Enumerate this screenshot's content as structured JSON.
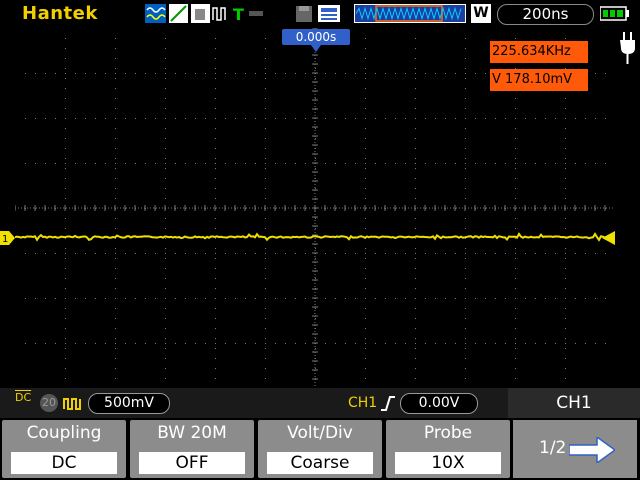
{
  "topbar": {
    "brand": "Hantek",
    "timebase": "200ns",
    "wave_mode": "W"
  },
  "screen": {
    "trigger_position": "0.000s",
    "measurements": [
      {
        "label": "225.634KHz"
      },
      {
        "label": "V 178.10mV"
      }
    ],
    "channel_marker": "1"
  },
  "status": {
    "coupling_icon": "DC",
    "bw_icon": "20",
    "volts_div": "500mV",
    "trigger_channel": "CH1",
    "trigger_level": "0.00V",
    "active_channel": "CH1"
  },
  "menu": {
    "items": [
      {
        "label": "Coupling",
        "value": "DC"
      },
      {
        "label": "BW 20M",
        "value": "OFF"
      },
      {
        "label": "Volt/Div",
        "value": "Coarse"
      },
      {
        "label": "Probe",
        "value": "10X"
      }
    ],
    "page": "1/2"
  },
  "colors": {
    "trace": "#f0e000",
    "brand": "#f0d000",
    "measurement_bg": "#ff5a0a",
    "trigger_marker": "#3060c8"
  }
}
